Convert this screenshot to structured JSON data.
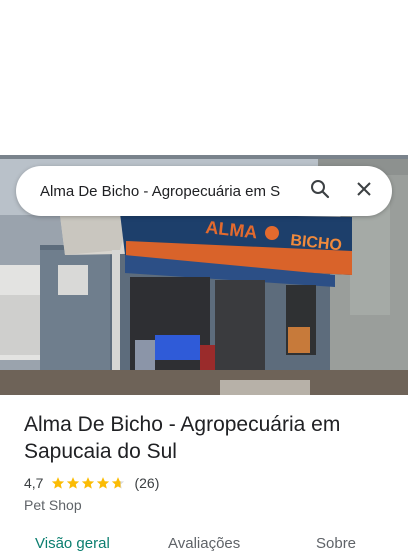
{
  "search": {
    "query": "Alma De Bicho - Agropecuária em S",
    "search_icon": "search-icon",
    "close_icon": "close-icon"
  },
  "photo": {
    "sign_text": "ALMA BICHO"
  },
  "place": {
    "title": "Alma De Bicho - Agropecuária em Sapucaia do Sul",
    "rating": "4,7",
    "rating_value": 4.7,
    "review_count": "(26)",
    "category": "Pet Shop"
  },
  "tabs": [
    {
      "label": "Visão geral",
      "active": true
    },
    {
      "label": "Avaliações",
      "active": false
    },
    {
      "label": "Sobre",
      "active": false
    }
  ],
  "colors": {
    "accent": "#0b7e6f",
    "star": "#fbbc04"
  }
}
